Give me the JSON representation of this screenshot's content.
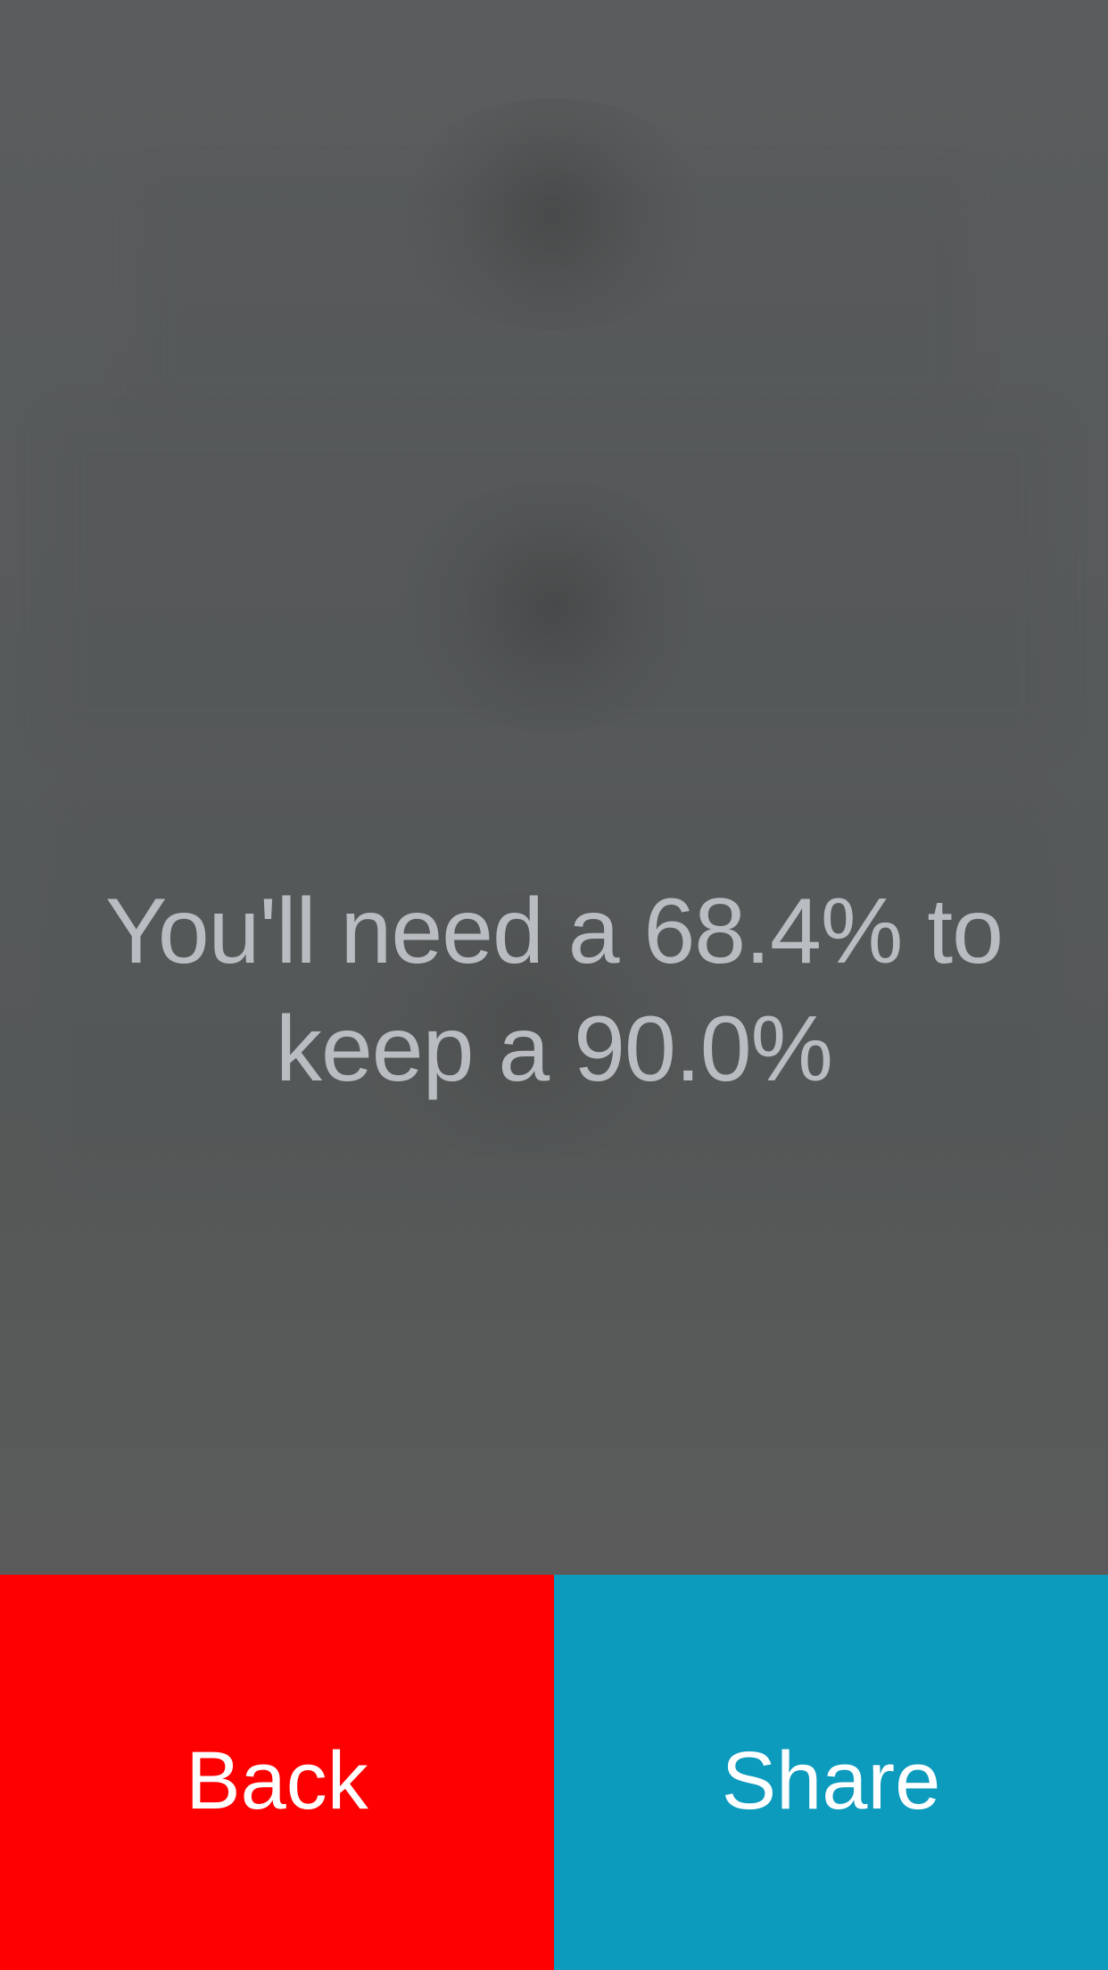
{
  "result": {
    "message": "You'll need a 68.4% to keep a 90.0%"
  },
  "actions": {
    "back_label": "Back",
    "share_label": "Share"
  },
  "colors": {
    "background": "#585a5a",
    "message_text": "#b9bdc1",
    "back_button": "#fe0000",
    "share_button": "#0c9abd",
    "button_text": "#ffffff"
  }
}
